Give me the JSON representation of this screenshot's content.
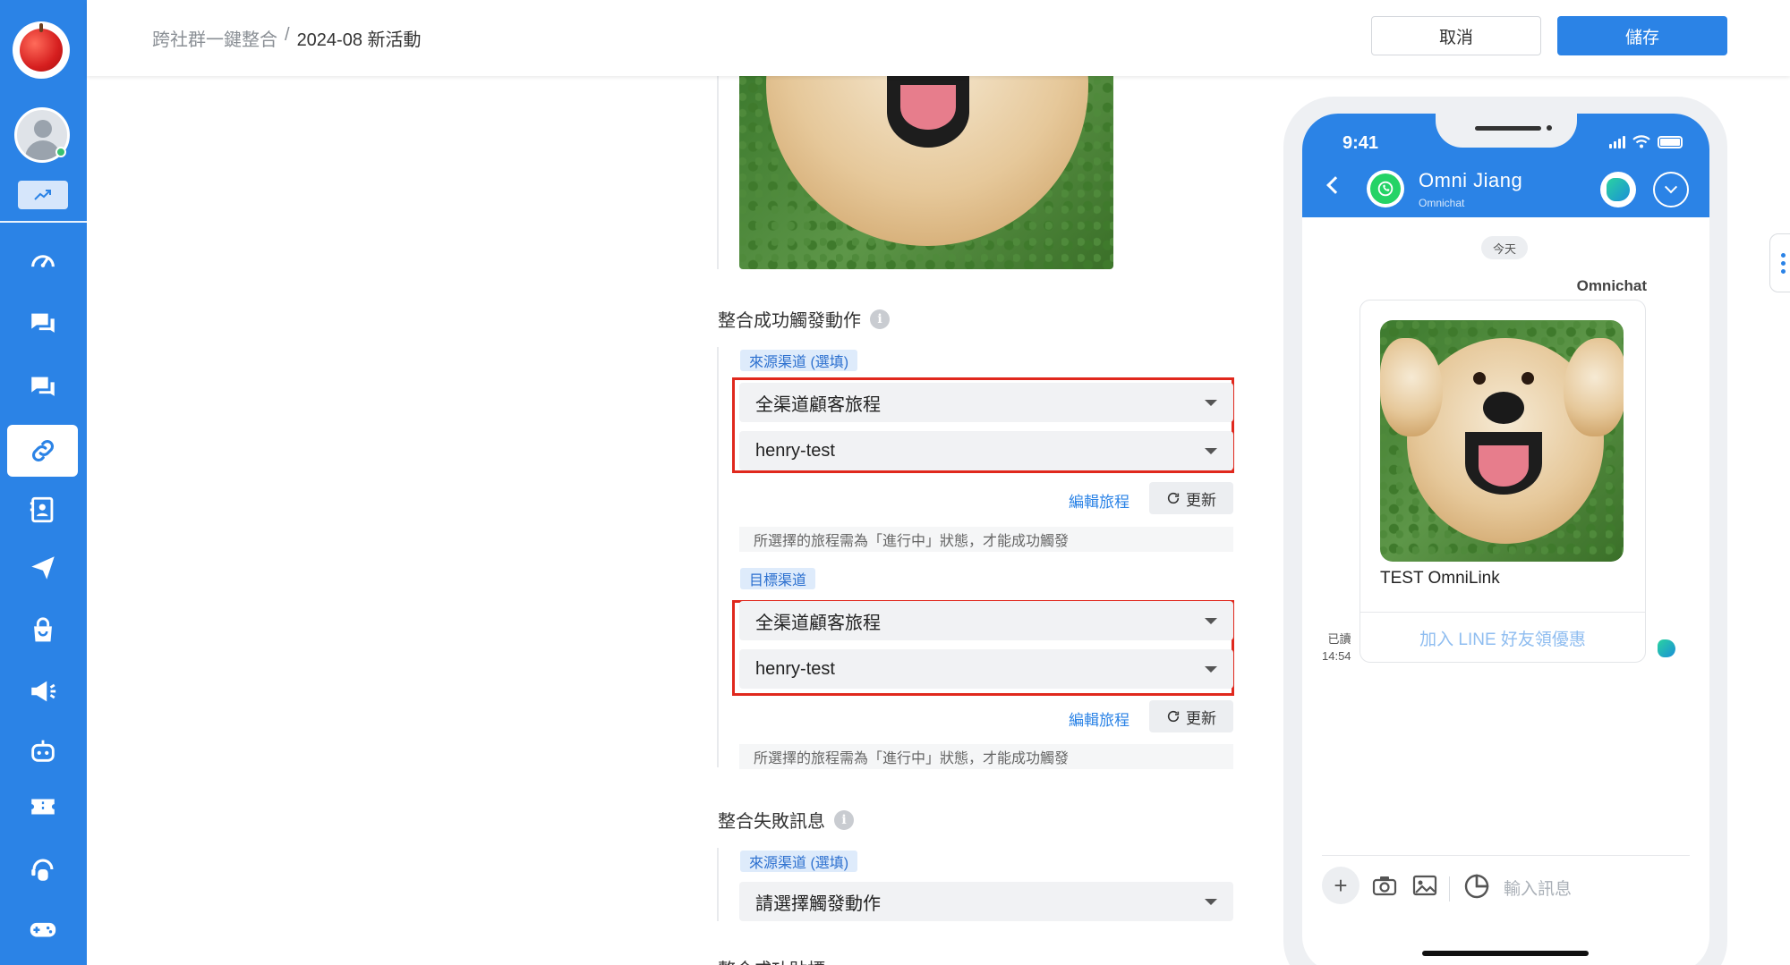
{
  "breadcrumb": {
    "parent": "跨社群一鍵整合",
    "separator": "/",
    "current": "2024-08 新活動"
  },
  "header": {
    "cancel_label": "取消",
    "save_label": "儲存"
  },
  "sidebar": {
    "items": [
      {
        "name": "dashboard",
        "icon": "speedometer-icon"
      },
      {
        "name": "chat",
        "icon": "chat-bubbles-icon"
      },
      {
        "name": "chat-2",
        "icon": "chat-bubbles-icon"
      },
      {
        "name": "omnilink",
        "icon": "link-icon",
        "active": true
      },
      {
        "name": "contacts",
        "icon": "contact-book-icon"
      },
      {
        "name": "broadcast",
        "icon": "paper-plane-icon"
      },
      {
        "name": "shop",
        "icon": "shop-bag-icon"
      },
      {
        "name": "campaign",
        "icon": "megaphone-icon"
      },
      {
        "name": "bot",
        "icon": "robot-icon"
      },
      {
        "name": "ticket",
        "icon": "ticket-icon"
      },
      {
        "name": "support",
        "icon": "agent-icon"
      },
      {
        "name": "game",
        "icon": "gamepad-icon"
      }
    ]
  },
  "form": {
    "success_title": "整合成功觸發動作",
    "source_channel_tag": "來源渠道 (選填)",
    "source_journey_type": "全渠道顧客旅程",
    "source_journey_name": "henry-test",
    "edit_journey_label": "編輯旅程",
    "refresh_label": "更新",
    "journey_hint": "所選擇的旅程需為「進行中」狀態，才能成功觸發",
    "target_channel_tag": "目標渠道",
    "target_journey_type": "全渠道顧客旅程",
    "target_journey_name": "henry-test",
    "fail_title": "整合失敗訊息",
    "fail_source_tag": "來源渠道 (選填)",
    "fail_action_placeholder": "請選擇觸發動作",
    "next_title_partial": "整合成功貼標"
  },
  "phone": {
    "time": "9:41",
    "contact_name": "Omni Jiang",
    "contact_sub": "Omnichat",
    "today_label": "今天",
    "sender": "Omnichat",
    "card_title": "TEST OmniLink",
    "card_button": "加入 LINE 好友領優惠",
    "read_label": "已讀",
    "read_time": "14:54",
    "input_placeholder": "輸入訊息"
  },
  "colors": {
    "brand": "#2b83e6",
    "highlight_frame": "#e0281d",
    "whatsapp": "#25d366"
  }
}
